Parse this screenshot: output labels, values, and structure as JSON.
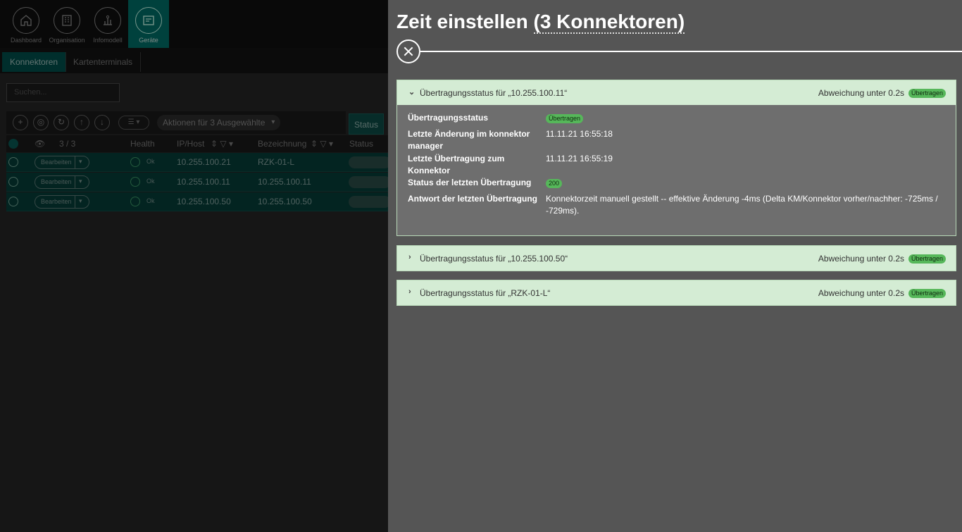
{
  "nav": {
    "items": [
      {
        "label": "Dashboard",
        "icon": "home-icon"
      },
      {
        "label": "Organisation",
        "icon": "building-icon"
      },
      {
        "label": "Infomodell",
        "icon": "model-icon"
      },
      {
        "label": "Geräte",
        "icon": "devices-icon",
        "active": true
      }
    ]
  },
  "subtabs": [
    "Konnektoren",
    "Kartenterminals"
  ],
  "search": {
    "placeholder": "Suchen..."
  },
  "toolbar": {
    "actions_label": "Aktionen für 3 Ausgewählte",
    "status_tab": "Status"
  },
  "table": {
    "selection_count": "3 / 3",
    "headers": {
      "health": "Health",
      "ip": "IP/Host",
      "bezeichnung": "Bezeichnung",
      "status": "Status"
    },
    "rows": [
      {
        "edit": "Bearbeiten",
        "health": "Ok",
        "ip": "10.255.100.21",
        "bezeichnung": "RZK-01-L"
      },
      {
        "edit": "Bearbeiten",
        "health": "Ok",
        "ip": "10.255.100.11",
        "bezeichnung": "10.255.100.11"
      },
      {
        "edit": "Bearbeiten",
        "health": "Ok",
        "ip": "10.255.100.50",
        "bezeichnung": "10.255.100.50"
      }
    ]
  },
  "panel": {
    "title_prefix": "Zeit einstellen ",
    "title_count": "(3 Konnektoren)",
    "accordions": [
      {
        "label": "Übertragungsstatus für „10.255.100.11“",
        "deviation": "Abweichung unter 0.2s",
        "badge": "Übertragen",
        "expanded": true,
        "details": {
          "k1": "Übertragungsstatus",
          "v1": "Übertragen",
          "k2": "Letzte Änderung im konnektor manager",
          "v2": "11.11.21 16:55:18",
          "k3": "Letzte Übertragung zum Konnektor",
          "v3": "11.11.21 16:55:19",
          "k4": "Status der letzten Übertragung",
          "v4": "200",
          "k5": "Antwort der letzten Übertragung",
          "v5": "Konnektorzeit manuell gestellt -- effektive Änderung -4ms (Delta KM/Konnektor vorher/nachher: -725ms / -729ms)."
        }
      },
      {
        "label": "Übertragungsstatus für „10.255.100.50“",
        "deviation": "Abweichung unter 0.2s",
        "badge": "Übertragen",
        "expanded": false
      },
      {
        "label": "Übertragungsstatus für „RZK-01-L“",
        "deviation": "Abweichung unter 0.2s",
        "badge": "Übertragen",
        "expanded": false
      }
    ]
  },
  "colors": {
    "accent": "#00706a",
    "success_bg": "#d4ecd4",
    "badge": "#56b75a",
    "panel_bg": "#555555"
  }
}
